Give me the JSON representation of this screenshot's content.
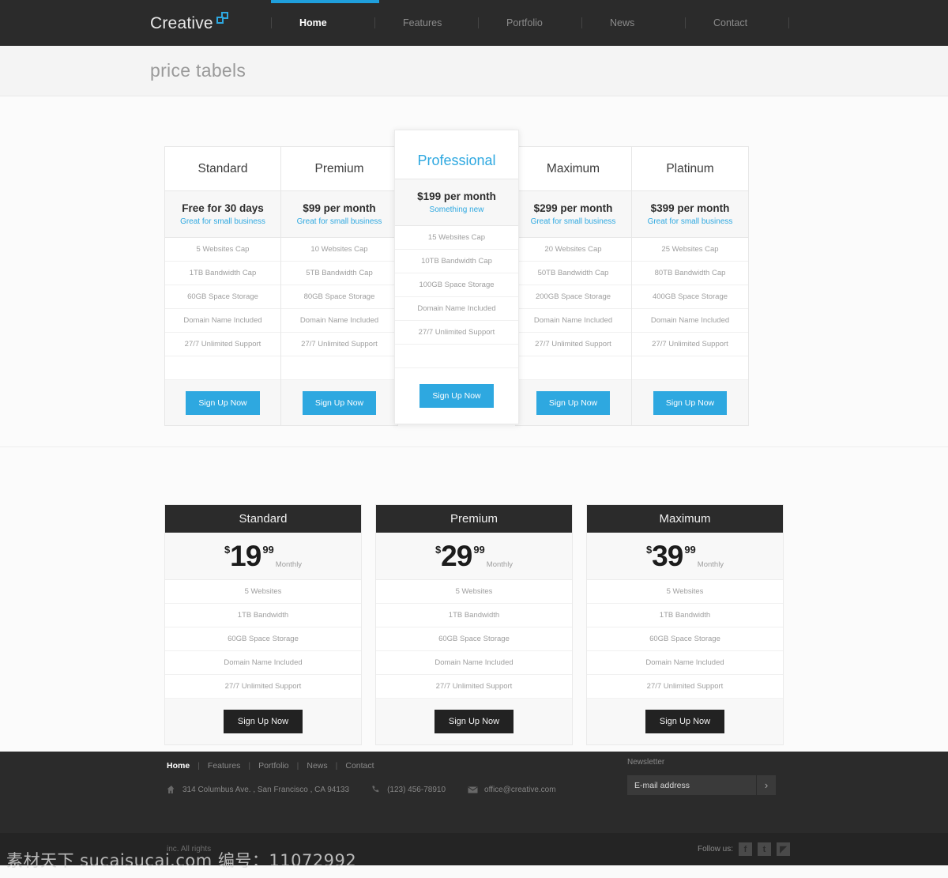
{
  "header": {
    "logo_text": "Creative",
    "logo_icon": "overlapping-squares-icon",
    "nav": [
      {
        "label": "Home",
        "active": true
      },
      {
        "label": "Features",
        "active": false
      },
      {
        "label": "Portfolio",
        "active": false
      },
      {
        "label": "News",
        "active": false
      },
      {
        "label": "Contact",
        "active": false
      }
    ]
  },
  "page_title": "price tabels",
  "comparison_table": {
    "columns": [
      {
        "name": "Standard",
        "price": "Free for 30 days",
        "tagline": "Great for small business",
        "featured": false,
        "features": [
          "5 Websites Cap",
          "1TB Bandwidth Cap",
          "60GB Space Storage",
          "Domain Name Included",
          "27/7 Unlimited Support"
        ],
        "cta": "Sign Up Now"
      },
      {
        "name": "Premium",
        "price": "$99 per month",
        "tagline": "Great for small business",
        "featured": false,
        "features": [
          "10 Websites Cap",
          "5TB Bandwidth Cap",
          "80GB Space Storage",
          "Domain Name Included",
          "27/7 Unlimited Support"
        ],
        "cta": "Sign Up Now"
      },
      {
        "name": "Professional",
        "price": "$199 per month",
        "tagline": "Something new",
        "featured": true,
        "features": [
          "15 Websites Cap",
          "10TB Bandwidth Cap",
          "100GB Space Storage",
          "Domain Name Included",
          "27/7 Unlimited Support"
        ],
        "cta": "Sign Up Now"
      },
      {
        "name": "Maximum",
        "price": "$299 per month",
        "tagline": "Great for small business",
        "featured": false,
        "features": [
          "20 Websites Cap",
          "50TB Bandwidth Cap",
          "200GB Space Storage",
          "Domain Name Included",
          "27/7 Unlimited Support"
        ],
        "cta": "Sign Up Now"
      },
      {
        "name": "Platinum",
        "price": "$399 per month",
        "tagline": "Great for small business",
        "featured": false,
        "features": [
          "25 Websites Cap",
          "80TB Bandwidth Cap",
          "400GB Space Storage",
          "Domain Name Included",
          "27/7 Unlimited Support"
        ],
        "cta": "Sign Up Now"
      }
    ]
  },
  "price_cards": [
    {
      "name": "Standard",
      "currency": "$",
      "amount": "19",
      "cents": "99",
      "period": "Monthly",
      "features": [
        "5 Websites",
        "1TB Bandwidth",
        "60GB Space Storage",
        "Domain Name Included",
        "27/7 Unlimited Support"
      ],
      "cta": "Sign Up Now"
    },
    {
      "name": "Premium",
      "currency": "$",
      "amount": "29",
      "cents": "99",
      "period": "Monthly",
      "features": [
        "5 Websites",
        "1TB Bandwidth",
        "60GB Space Storage",
        "Domain Name Included",
        "27/7 Unlimited Support"
      ],
      "cta": "Sign Up Now"
    },
    {
      "name": "Maximum",
      "currency": "$",
      "amount": "39",
      "cents": "99",
      "period": "Monthly",
      "features": [
        "5 Websites",
        "1TB Bandwidth",
        "60GB Space Storage",
        "Domain Name Included",
        "27/7 Unlimited Support"
      ],
      "cta": "Sign Up Now"
    }
  ],
  "footer": {
    "links": [
      {
        "label": "Home",
        "active": true
      },
      {
        "label": "Features",
        "active": false
      },
      {
        "label": "Portfolio",
        "active": false
      },
      {
        "label": "News",
        "active": false
      },
      {
        "label": "Contact",
        "active": false
      }
    ],
    "separator": "|",
    "contact": {
      "address": "314 Columbus Ave. , San Francisco , CA 94133",
      "address_icon": "home-icon",
      "phone": "(123) 456-78910",
      "phone_icon": "phone-icon",
      "email": "office@creative.com",
      "email_icon": "envelope-icon"
    },
    "newsletter": {
      "label": "Newsletter",
      "value": "E-mail address",
      "placeholder": "E-mail address",
      "submit_icon": "chevron-right-icon"
    },
    "follow_label": "Follow us:",
    "social": [
      {
        "name": "facebook-icon",
        "glyph": "f"
      },
      {
        "name": "twitter-icon",
        "glyph": "t"
      },
      {
        "name": "rss-icon",
        "glyph": "◤"
      }
    ],
    "copyright": "inc. All rights"
  },
  "watermark": "素材天下 sucaisucai.com 编号：11072992",
  "colors": {
    "accent": "#2ea8e0",
    "dark": "#2b2b2b",
    "page_bg": "#fbfbfb"
  }
}
